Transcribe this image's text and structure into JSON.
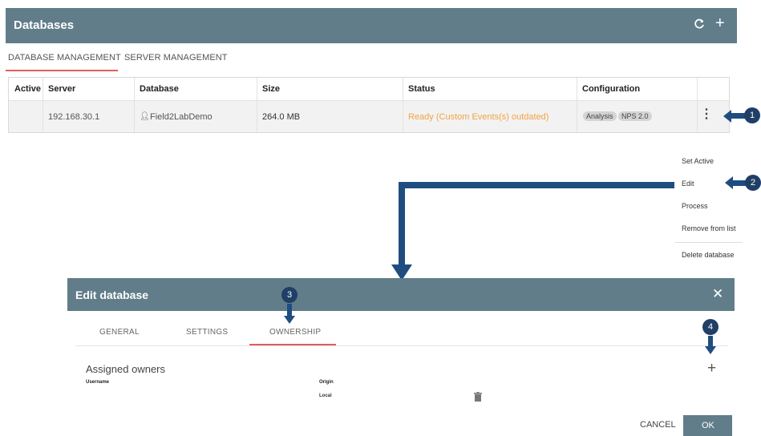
{
  "header": {
    "title": "Databases",
    "refresh_icon": "refresh-icon",
    "add_icon": "plus-icon"
  },
  "tabs": [
    {
      "label": "DATABASE MANAGEMENT",
      "active": true
    },
    {
      "label": "SERVER MANAGEMENT",
      "active": false
    }
  ],
  "table": {
    "columns": [
      "Active",
      "Server",
      "Database",
      "Size",
      "Status",
      "Configuration"
    ],
    "rows": [
      {
        "active": "",
        "server": "192.168.30.1",
        "database": "Field2LabDemo",
        "size": "264.0 MB",
        "status": "Ready (Custom Events(s) outdated)",
        "configuration": [
          "Analysis",
          "NPS 2.0"
        ]
      }
    ]
  },
  "menu": {
    "items": [
      "Set Active",
      "Edit",
      "Process",
      "Remove from list",
      "Delete database"
    ]
  },
  "callouts": [
    "1",
    "2",
    "3",
    "4"
  ],
  "dialog": {
    "title": "Edit database",
    "tabs": [
      "GENERAL",
      "SETTINGS",
      "OWNERSHIP"
    ],
    "active_tab": "OWNERSHIP",
    "section_title": "Assigned owners",
    "columns": [
      "Username",
      "Origin"
    ],
    "rows": [
      {
        "username": "",
        "origin": "Local"
      }
    ],
    "cancel_label": "CANCEL",
    "ok_label": "OK"
  },
  "colors": {
    "header": "#617d8a",
    "accent": "#e25d5d",
    "status": "#f2a444",
    "callout": "#1f3f66",
    "arrow": "#1f4d80"
  }
}
